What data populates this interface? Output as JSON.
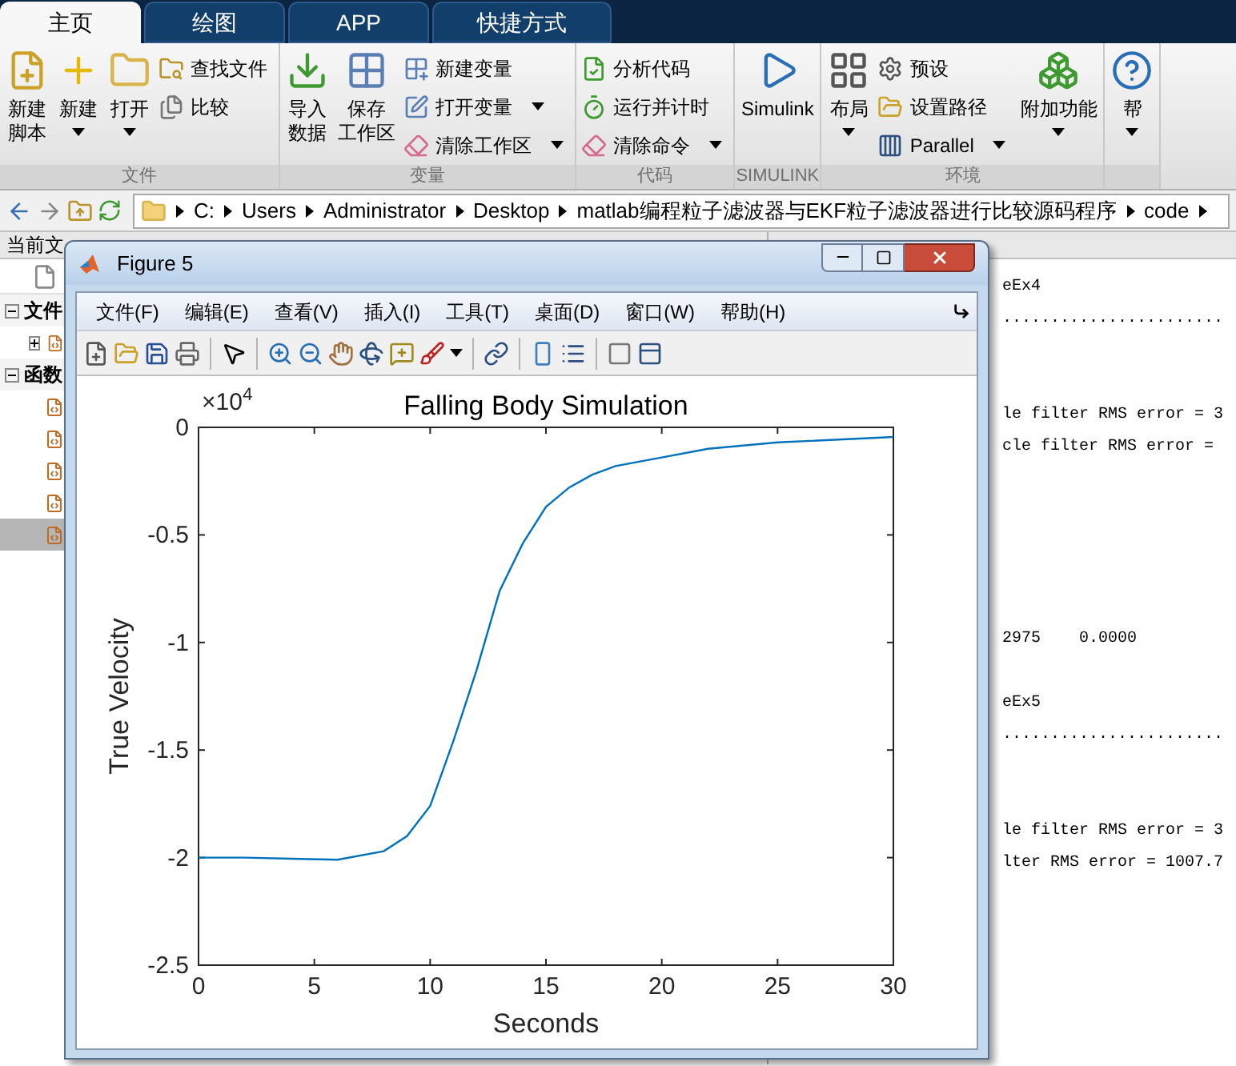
{
  "tabs": [
    {
      "label": "主页",
      "selected": true
    },
    {
      "label": "绘图",
      "selected": false
    },
    {
      "label": "APP",
      "selected": false
    },
    {
      "label": "快捷方式",
      "selected": false
    }
  ],
  "ribbon_groups": [
    {
      "title": "文件",
      "columns": [
        {
          "kind": "large",
          "lines": [
            "新建",
            "脚本"
          ],
          "dropdown": false
        },
        {
          "kind": "large",
          "lines": [
            "新建"
          ],
          "dropdown": true
        },
        {
          "kind": "large",
          "lines": [
            "打开"
          ],
          "dropdown": true
        },
        {
          "kind": "stack",
          "items": [
            {
              "label": "查找文件",
              "dropdown": false
            },
            {
              "label": "比较",
              "dropdown": false
            }
          ]
        }
      ]
    },
    {
      "title": "变量",
      "columns": [
        {
          "kind": "large",
          "lines": [
            "导入",
            "数据"
          ],
          "dropdown": false
        },
        {
          "kind": "large",
          "lines": [
            "保存",
            "工作区"
          ],
          "dropdown": false
        },
        {
          "kind": "stack",
          "items": [
            {
              "label": "新建变量",
              "dropdown": false
            },
            {
              "label": "打开变量",
              "dropdown": true
            },
            {
              "label": "清除工作区",
              "dropdown": true
            }
          ]
        }
      ]
    },
    {
      "title": "代码",
      "columns": [
        {
          "kind": "stack",
          "items": [
            {
              "label": "分析代码",
              "dropdown": false
            },
            {
              "label": "运行并计时",
              "dropdown": false
            },
            {
              "label": "清除命令",
              "dropdown": true
            }
          ]
        }
      ]
    },
    {
      "title": "SIMULINK",
      "columns": [
        {
          "kind": "large",
          "lines": [
            "Simulink"
          ],
          "dropdown": false
        }
      ]
    },
    {
      "title": "环境",
      "columns": [
        {
          "kind": "large",
          "lines": [
            "布局"
          ],
          "dropdown": true
        },
        {
          "kind": "stack",
          "items": [
            {
              "label": "预设",
              "dropdown": false
            },
            {
              "label": "设置路径",
              "dropdown": false
            },
            {
              "label": "Parallel",
              "dropdown": true
            }
          ]
        },
        {
          "kind": "large",
          "lines": [
            "附加功能"
          ],
          "dropdown": true
        }
      ]
    },
    {
      "columns": [
        {
          "kind": "large",
          "lines": [
            "帮"
          ],
          "dropdown": true
        }
      ]
    }
  ],
  "path": [
    "C:",
    "Users",
    "Administrator",
    "Desktop",
    "matlab编程粒子滤波器与EKF粒子滤波器进行比较源码程序",
    "code"
  ],
  "current_folder": {
    "title": "当前文",
    "tree": [
      {
        "label": "文件",
        "expanded": true,
        "children": [
          {
            "expanded": false
          }
        ]
      },
      {
        "label": "函数",
        "expanded": true,
        "children": [
          {
            "selected": false
          },
          {
            "selected": false
          },
          {
            "selected": false
          },
          {
            "selected": false
          },
          {
            "selected": true
          }
        ]
      }
    ]
  },
  "console": {
    "lines": [
      "eEx4",
      ".......................",
      "le filter RMS error = 3",
      "cle filter RMS error =",
      "2975    0.0000",
      "eEx5",
      ".......................",
      "le filter RMS error = 3",
      "lter RMS error = 1007.7"
    ]
  },
  "figure": {
    "title": "Figure 5",
    "menu": [
      "文件(F)",
      "编辑(E)",
      "查看(V)",
      "插入(I)",
      "工具(T)",
      "桌面(D)",
      "窗口(W)",
      "帮助(H)"
    ],
    "chart_data": {
      "type": "line",
      "title": "Falling Body Simulation",
      "xlabel": "Seconds",
      "ylabel": "True Velocity",
      "x": [
        0,
        2,
        4,
        6,
        8,
        9,
        10,
        11,
        12,
        13,
        14,
        15,
        16,
        17,
        18,
        20,
        22,
        25,
        30
      ],
      "series": [
        {
          "color": "#0072bd",
          "values": [
            -2,
            -2,
            -2.005,
            -2.01,
            -1.97,
            -1.9,
            -1.76,
            -1.46,
            -1.13,
            -0.76,
            -0.54,
            -0.37,
            -0.28,
            -0.22,
            -0.18,
            -0.14,
            -0.1,
            -0.07,
            -0.045
          ]
        }
      ],
      "xlim": [
        0,
        30
      ],
      "ylim": [
        -2.5,
        0
      ],
      "xticks": [
        0,
        5,
        10,
        15,
        20,
        25,
        30
      ],
      "yticks": [
        -2.5,
        -2,
        -1.5,
        -1,
        -0.5,
        0
      ],
      "annotations": [
        "×10$^{4}$"
      ]
    }
  }
}
